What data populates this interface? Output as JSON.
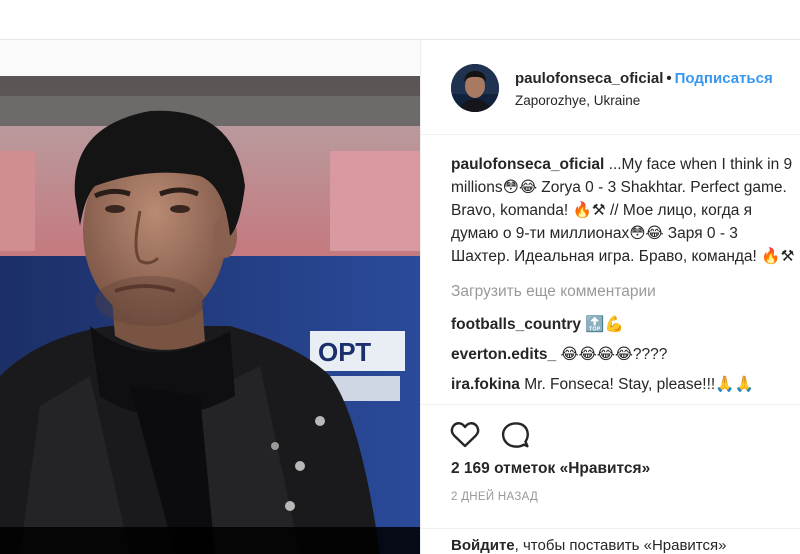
{
  "post": {
    "author": {
      "username": "paulofonseca_oficial",
      "separator": "•",
      "follow_label": "Подписаться",
      "location": "Zaporozhye, Ukraine"
    },
    "caption": {
      "username": "paulofonseca_oficial",
      "text": " ...My face when I think in 9 millions😳😂 Zorya 0 - 3 Shakhtar. Perfect game. Bravo, komanda! 🔥⚒ // Мое лицо, когда я думаю о 9-ти миллионах😳😂 Заря 0 - 3 Шахтер. Идеальная игра. Браво, команда! 🔥⚒"
    },
    "load_more_label": "Загрузить еще комментарии",
    "comments": [
      {
        "username": "footballs_country",
        "text": " 🔝💪"
      },
      {
        "username": "everton.edits_",
        "text": " 😂😂😂😂????"
      },
      {
        "username": "ira.fokina",
        "text": " Mr. Fonseca! Stay, please!!!🙏🙏"
      }
    ],
    "likes_label": "2 169 отметок «Нравится»",
    "time_label": "2 ДНЕЙ НАЗАД",
    "login": {
      "link_label": "Войдите",
      "rest_text": ", чтобы поставить «Нравится»"
    }
  },
  "icons": {
    "like": "heart-outline-icon",
    "comment": "speech-bubble-icon"
  },
  "colors": {
    "accent": "#3897f0",
    "muted": "#999999",
    "text": "#262626",
    "border": "#efefef"
  }
}
